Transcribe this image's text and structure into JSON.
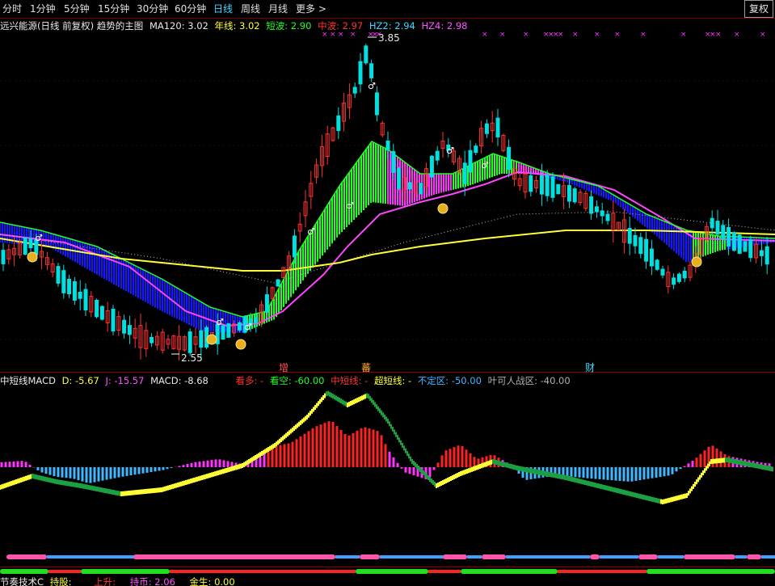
{
  "toolbar": {
    "tabs": [
      "分时",
      "1分钟",
      "5分钟",
      "15分钟",
      "30分钟",
      "60分钟",
      "日线",
      "周线",
      "月线",
      "更多 >"
    ],
    "active_tab": "日线",
    "fuquan": "复权"
  },
  "main_header": {
    "title": "远兴能源(日线 前复权) 趋势的主图",
    "ma120": "MA120: 3.02",
    "nianxian": "年线: 3.02",
    "duanbo": "短波: 2.90",
    "zhongbo": "中波: 2.97",
    "hz2": "HZ2: 2.94",
    "hz4": "HZ4: 2.98"
  },
  "price_annotations": {
    "high": "3.85",
    "low": "2.55"
  },
  "event_markers": {
    "zeng": "增",
    "fan": "蕃",
    "cai": "财"
  },
  "macd_header": {
    "name": "中短线MACD",
    "d": "D: -5.67",
    "j": "J: -15.57",
    "macd": "MACD: -8.68",
    "kanduo": "看多: -",
    "kankong": "看空: -60.00",
    "zhongduan": "中短线: -",
    "chaoduan": "超短线: -",
    "budingqu": "不定区: -50.00",
    "yeke": "叶可人战区: -40.00"
  },
  "bottom_header": {
    "name": "节奏技术C",
    "chigu": "持股:",
    "shangsheng": "上升:",
    "chibi": "持币: 2.06",
    "jinsheng": "金生: 0.00"
  },
  "colors": {
    "up": "#ff3232",
    "down": "#00e0e0",
    "ribbon_up": "#22ff22",
    "ribbon_down": "#1616ff",
    "ribbon_mid": "#ff33ff",
    "yearline": "#ffff33",
    "macd_pos": "#ff2222",
    "macd_neg": "#ff33ff"
  }
}
